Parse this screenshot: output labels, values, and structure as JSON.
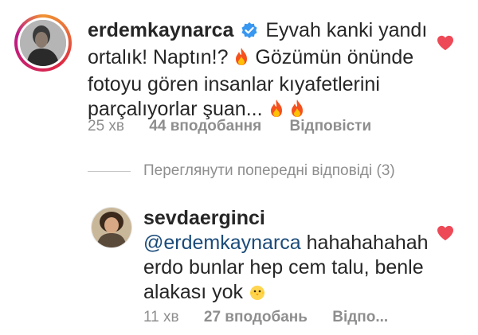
{
  "comment1": {
    "username": "erdemkaynarca",
    "verified": true,
    "lines": [
      "Eyvah kanki yandı",
      "ortalık! Naptın!?",
      "Gözümün önünde",
      "fotoyu gören insanlar kıyafetlerini",
      "parçalıyorlar şuan..."
    ],
    "time": "25 хв",
    "likes": "44 вподобання",
    "reply": "Відповісти",
    "emoji": "fire"
  },
  "view_replies": "Переглянути попередні відповіді (3)",
  "comment2": {
    "username": "sevdaerginci",
    "mention": "@erdemkaynarca",
    "line1_rest": " hahahahahah",
    "line2": "erdo bunlar hep cem talu, benle",
    "line3": "alakası yok",
    "time": "11 хв",
    "likes": "27 вподобань",
    "reply": "Відпо...",
    "emoji": "baby-chick"
  },
  "colors": {
    "heart": "#ed4956",
    "verified": "#3897f0",
    "text": "#262626",
    "secondary": "#8e8e8e",
    "mention": "#1b4b7a"
  }
}
